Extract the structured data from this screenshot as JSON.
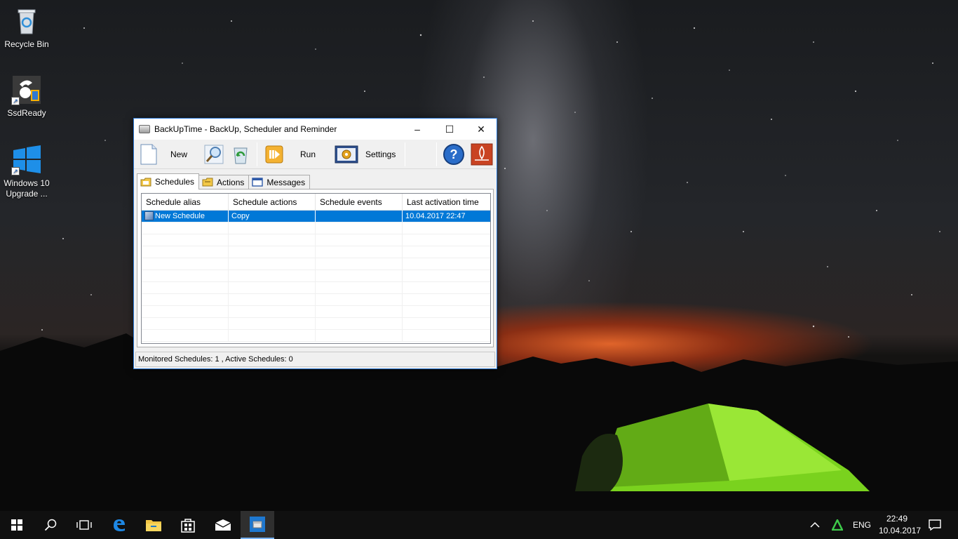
{
  "desktop": {
    "icons": [
      {
        "label": "Recycle Bin",
        "icon": "recycle-bin-icon"
      },
      {
        "label": "SsdReady",
        "icon": "ssdready-icon"
      },
      {
        "label": "Windows 10 Upgrade ...",
        "icon": "windows-logo-icon"
      }
    ]
  },
  "window": {
    "title": "BackUpTime - BackUp, Scheduler and Reminder",
    "controls": {
      "minimize": "–",
      "maximize": "☐",
      "close": "✕"
    },
    "toolbar": {
      "new_label": "New",
      "run_label": "Run",
      "settings_label": "Settings"
    },
    "tabs": [
      {
        "label": "Schedules",
        "active": true
      },
      {
        "label": "Actions",
        "active": false
      },
      {
        "label": "Messages",
        "active": false
      }
    ],
    "table": {
      "columns": [
        "Schedule alias",
        "Schedule actions",
        "Schedule events",
        "Last activation time"
      ],
      "rows": [
        {
          "alias": "New Schedule",
          "actions": "Copy",
          "events": "",
          "last": "10.04.2017 22:47",
          "selected": true
        }
      ]
    },
    "status": "Monitored Schedules: 1 , Active Schedules: 0"
  },
  "taskbar": {
    "language": "ENG",
    "time": "22:49",
    "date": "10.04.2017"
  },
  "colors": {
    "accent": "#0078d7",
    "window_border": "#2b78d6",
    "taskbar": "#101010"
  }
}
